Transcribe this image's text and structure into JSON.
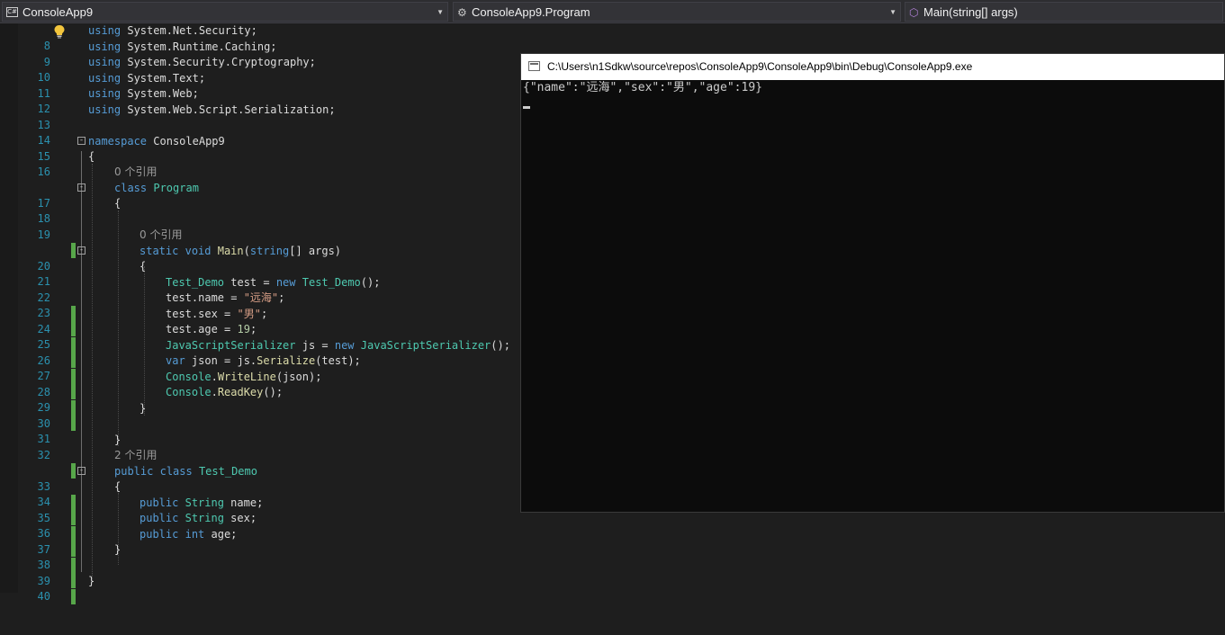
{
  "navbar": {
    "project": "ConsoleApp9",
    "type_member": "ConsoleApp9.Program",
    "method": "Main(string[] args)",
    "icons": [
      "csharp-project-icon",
      "class-icon",
      "method-icon"
    ]
  },
  "editor": {
    "line_numbers": [
      "8",
      "9",
      "10",
      "11",
      "12",
      "13",
      "14",
      "15",
      "16",
      "17",
      "18",
      "19",
      "20",
      "21",
      "22",
      "23",
      "24",
      "25",
      "26",
      "27",
      "28",
      "29",
      "30",
      "31",
      "32",
      "33",
      "34",
      "35",
      "36",
      "37",
      "38",
      "39",
      "40"
    ],
    "references": {
      "program": "0 个引用",
      "main": "0 个引用",
      "test_demo": "2 个引用"
    },
    "tokens": {
      "using": "using",
      "ns_net_security": "System.Net.Security;",
      "ns_runtime_caching": "System.Runtime.Caching;",
      "ns_security_crypto": "System.Security.Cryptography;",
      "ns_text": "System.Text;",
      "ns_web": "System.Web;",
      "ns_web_script": "System.Web.Script.Serialization;",
      "namespace": "namespace",
      "namespace_name": "ConsoleApp9",
      "open_brace": "{",
      "close_brace": "}",
      "class": "class",
      "program": "Program",
      "static": "static",
      "void": "void",
      "main": "Main",
      "main_open": "(",
      "string_kw": "string",
      "main_params_rest": "[] args)",
      "test_demo": "Test_Demo",
      "test_decl": " test = ",
      "new_kw": "new",
      "test_demo_ctor": " Test_Demo",
      "ctor_end": "();",
      "test_name": "test.name = ",
      "name_value": "\"远海\"",
      "semi": ";",
      "test_sex": "test.sex = ",
      "sex_value": "\"男\"",
      "test_age": "test.age = ",
      "age_value": "19",
      "jss_type": "JavaScriptSerializer",
      "jss_decl": " js = ",
      "jss_type2": " JavaScriptSerializer",
      "var_kw": "var",
      "json_decl": " json = js.",
      "serialize": "Serialize",
      "serialize_args": "(test);",
      "console": "Console",
      "dot": ".",
      "writeline": "WriteLine",
      "writeline_args": "(json);",
      "readkey": "ReadKey",
      "readkey_args": "();",
      "public_kw": "public",
      "string_type": "String",
      "name_field": " name;",
      "sex_field": " sex;",
      "int_kw": "int",
      "age_field": " age;"
    }
  },
  "console": {
    "title": "C:\\Users\\n1Sdkw\\source\\repos\\ConsoleApp9\\ConsoleApp9\\bin\\Debug\\ConsoleApp9.exe",
    "output": "{\"name\":\"远海\",\"sex\":\"男\",\"age\":19}"
  }
}
